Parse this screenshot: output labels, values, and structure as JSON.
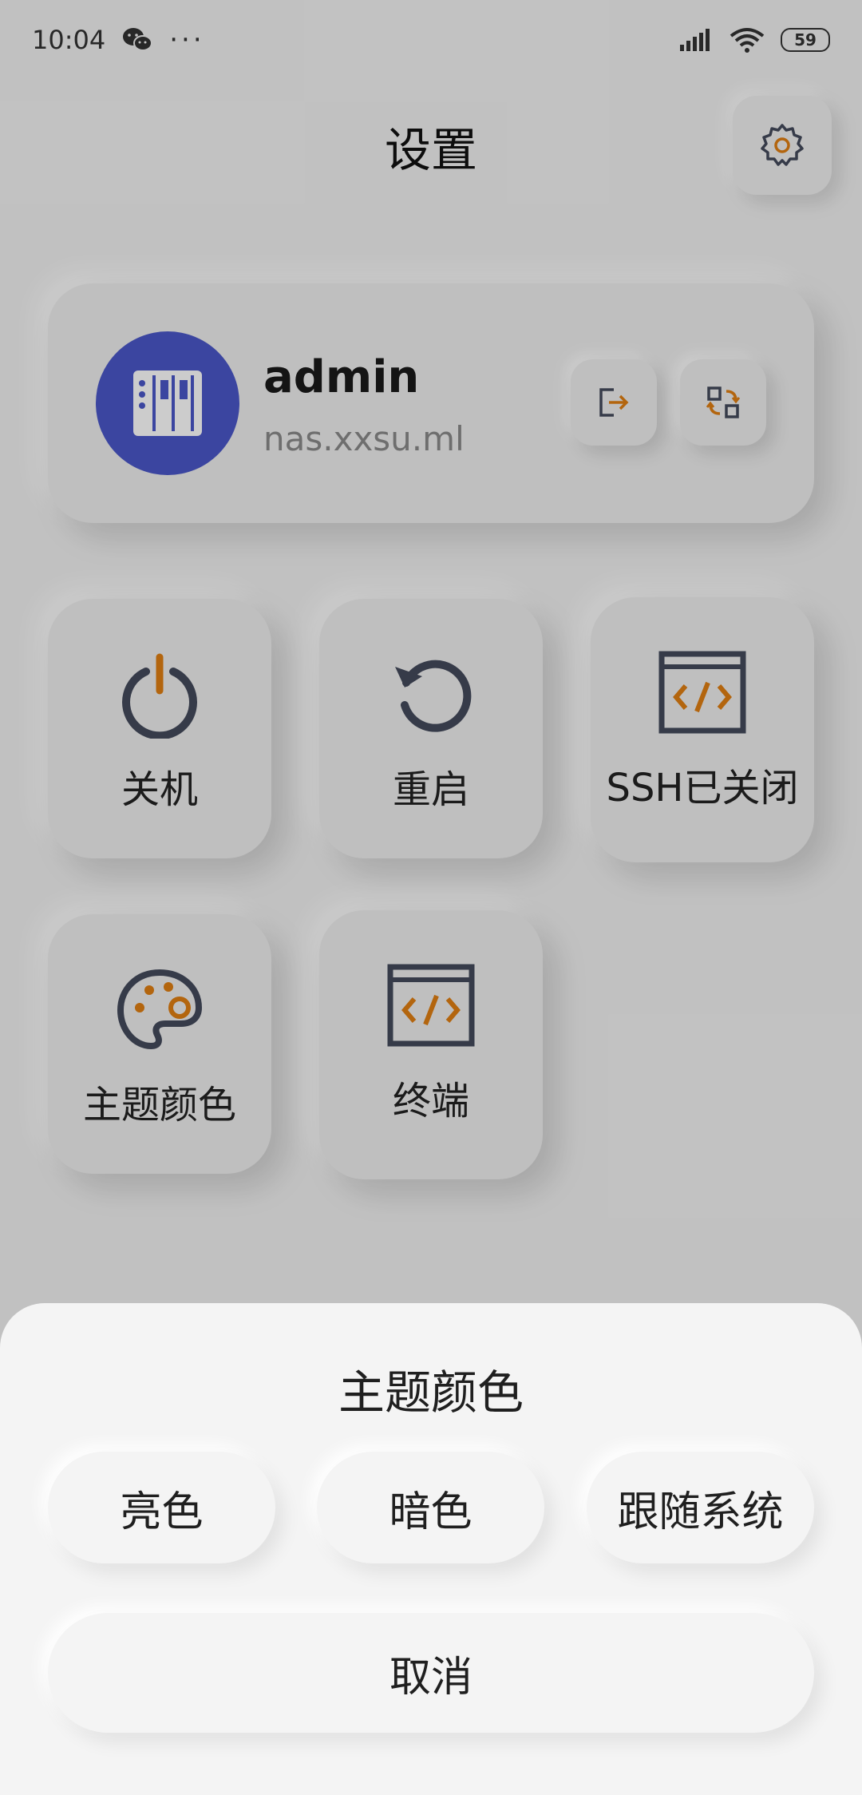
{
  "status_bar": {
    "time": "10:04",
    "dots": "···",
    "battery": "59",
    "icons": [
      "wechat-icon",
      "signal-icon",
      "wifi-icon",
      "battery-icon"
    ]
  },
  "header": {
    "title": "设置",
    "gear_icon": "gear-icon"
  },
  "account": {
    "name": "admin",
    "host": "nas.xxsu.ml",
    "avatar_color": "#4a57c8"
  },
  "tiles": {
    "shutdown": "关机",
    "reboot": "重启",
    "ssh": "SSH已关闭",
    "theme": "主题颜色",
    "terminal": "终端"
  },
  "colors": {
    "accent": "#e07f12",
    "icon_dark": "#444a5c",
    "background": "#f2f2f2"
  },
  "theme_sheet": {
    "title": "主题颜色",
    "options": [
      "亮色",
      "暗色",
      "跟随系统"
    ],
    "cancel": "取消"
  }
}
